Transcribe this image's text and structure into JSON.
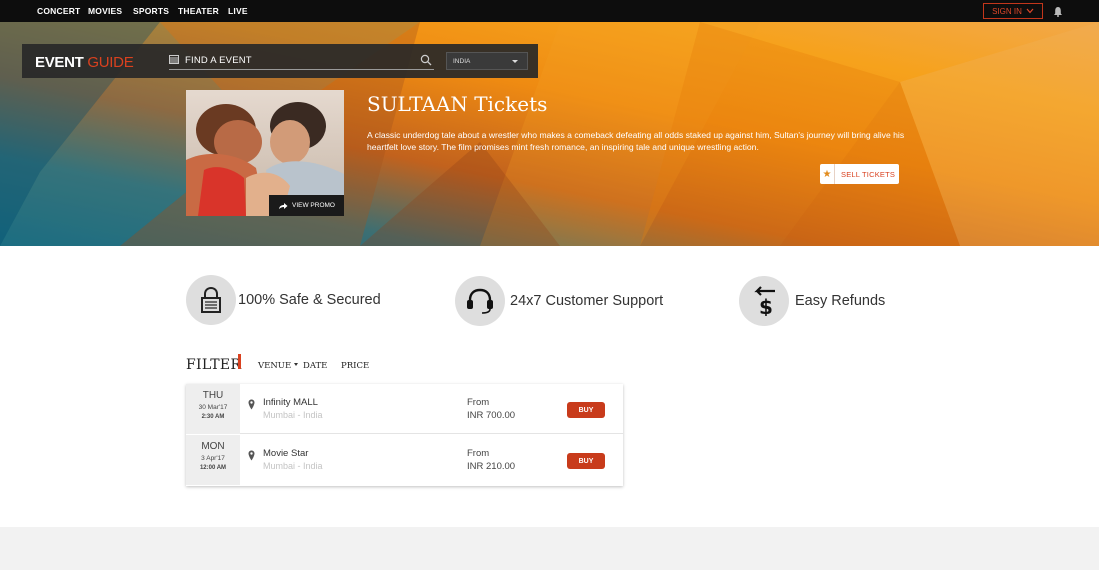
{
  "topnav": {
    "items": [
      "CONCERT",
      "MOVIES",
      "SPORTS",
      "THEATER",
      "LIVE"
    ],
    "signin_label": "SIGN IN"
  },
  "brand": {
    "logo_event": "EVENT",
    "logo_guide": "GUIDE",
    "search_placeholder": "FIND A EVENT",
    "country_value": "INDIA"
  },
  "hero": {
    "title": "SULTAAN Tickets",
    "description": "A classic underdog tale about a wrestler who makes a comeback defeating all odds staked up against him, Sultan's journey will bring alive his heartfelt love story. The film promises mint fresh romance, an inspiring tale and unique wrestling action.",
    "promo_label": "VIEW PROMO",
    "sell_label": "SELL TICKETS"
  },
  "features": [
    {
      "label": "100% Safe & Secured",
      "icon": "lock-icon"
    },
    {
      "label": "24x7 Customer Support",
      "icon": "headset-icon"
    },
    {
      "label": "Easy Refunds",
      "icon": "refund-dollar-icon"
    }
  ],
  "filter": {
    "title": "FILTER",
    "tabs": [
      "VENUE",
      "DATE",
      "PRICE"
    ]
  },
  "events": [
    {
      "dow": "THU",
      "date": "30 Mar'17",
      "time": "2:30 AM",
      "venue": "Infinity MALL",
      "location": "Mumbai - India",
      "from_label": "From",
      "price": "INR 700.00",
      "buy_label": "BUY"
    },
    {
      "dow": "MON",
      "date": "3 Apr'17",
      "time": "12:00 AM",
      "venue": "Movie Star",
      "location": "Mumbai - India",
      "from_label": "From",
      "price": "INR 210.00",
      "buy_label": "BUY"
    }
  ],
  "colors": {
    "accent": "#d9411f",
    "button": "#c83b1b",
    "topnav_bg": "#0d0d0d",
    "hero_orange": "#f39a1c",
    "hero_teal": "#1d6f86"
  }
}
